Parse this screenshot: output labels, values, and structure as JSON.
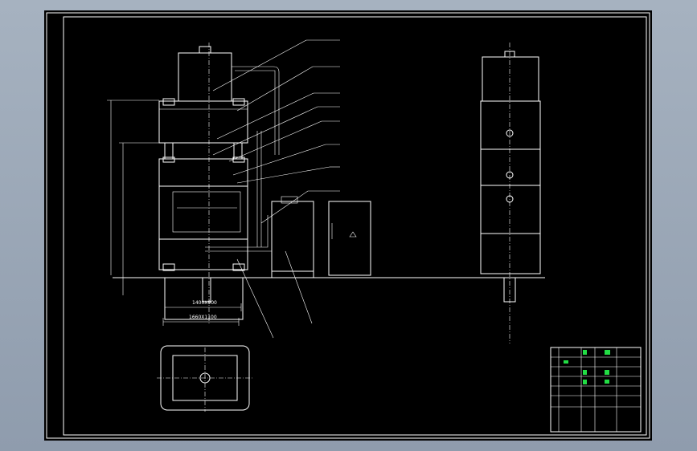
{
  "drawing": {
    "dim_main_width": "1660X1100",
    "dim_inner_width": "1400X900",
    "colors": {
      "background": "#000000",
      "line": "#ffffff",
      "annotation": "#22dd44",
      "viewport": "#9ba7b6"
    }
  }
}
